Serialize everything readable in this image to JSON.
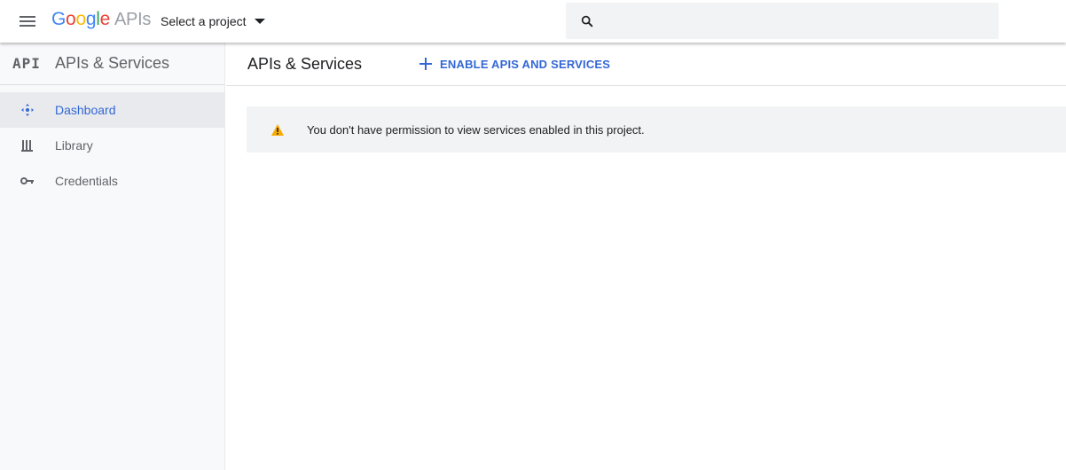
{
  "header": {
    "logo": {
      "word": "Google",
      "suffix": "APIs"
    },
    "project_selector": "Select a project",
    "search": {
      "placeholder": "",
      "value": ""
    }
  },
  "sidebar": {
    "badge": "API",
    "title": "APIs & Services",
    "items": [
      {
        "label": "Dashboard",
        "icon": "dashboard-icon",
        "active": true
      },
      {
        "label": "Library",
        "icon": "library-icon",
        "active": false
      },
      {
        "label": "Credentials",
        "icon": "key-icon",
        "active": false
      }
    ]
  },
  "main": {
    "title": "APIs & Services",
    "enable_button": "ENABLE APIS AND SERVICES",
    "alert": {
      "icon": "warning-icon",
      "text": "You don't have permission to view services enabled in this project."
    }
  },
  "colors": {
    "accent": "#3367d6",
    "warning": "#f9ab00",
    "sidebar_bg": "#f8f9fa",
    "alert_bg": "#f1f3f4"
  }
}
